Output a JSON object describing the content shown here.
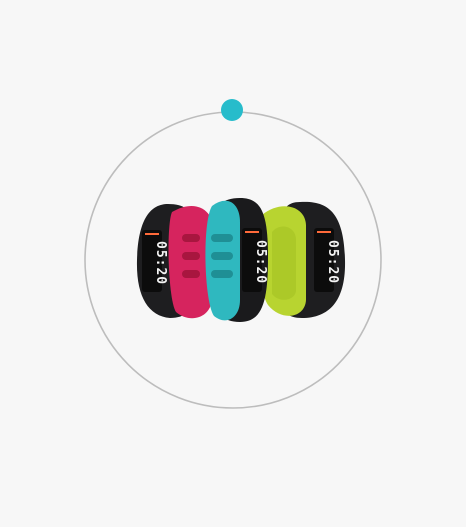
{
  "scene": {
    "background_color": "#f7f7f7",
    "ring_color": "#bdbdbd",
    "indicator_color": "#27bccb"
  },
  "bands": [
    {
      "name": "pink-band",
      "accent_color": "#d6245e",
      "display_text": "05:20"
    },
    {
      "name": "teal-band",
      "accent_color": "#2fb8bf",
      "display_text": "05:20"
    },
    {
      "name": "lime-band",
      "accent_color": "#b8d430",
      "display_text": "05:20"
    }
  ]
}
